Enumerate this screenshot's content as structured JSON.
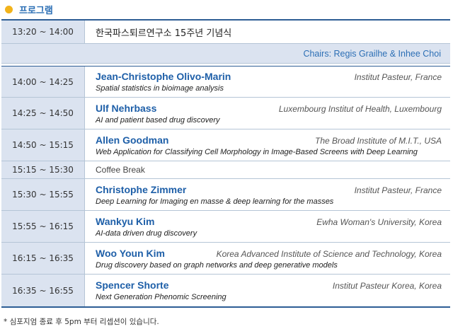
{
  "header": {
    "title": "프로그램"
  },
  "opening": {
    "time": "13:20 ~ 14:00",
    "title": "한국파스퇴르연구소 15주년 기념식"
  },
  "chairs": "Chairs: Regis Grailhe & Inhee Choi",
  "talks": [
    {
      "time": "14:00 ~ 14:25",
      "speaker": "Jean-Christophe Olivo-Marin",
      "affiliation": "Institut Pasteur, France",
      "title": "Spatial statistics in bioimage analysis"
    },
    {
      "time": "14:25 ~ 14:50",
      "speaker": "Ulf Nehrbass",
      "affiliation": "Luxembourg Institut of Health, Luxembourg",
      "title": "AI and patient based drug discovery"
    },
    {
      "time": "14:50 ~ 15:15",
      "speaker": "Allen Goodman",
      "affiliation": "The Broad Institute of M.I.T., USA",
      "title": "Web Application for Classifying Cell Morphology in Image-Based Screens with Deep Learning"
    }
  ],
  "coffee": {
    "time": "15:15 ~ 15:30",
    "label": "Coffee Break"
  },
  "talks2": [
    {
      "time": "15:30 ~ 15:55",
      "speaker": "Christophe Zimmer",
      "affiliation": "Institut Pasteur, France",
      "title": "Deep Learning for Imaging en masse & deep learning for the masses"
    },
    {
      "time": "15:55 ~ 16:15",
      "speaker": "Wankyu Kim",
      "affiliation": "Ewha Woman's University, Korea",
      "title": "AI-data driven drug discovery"
    },
    {
      "time": "16:15 ~ 16:35",
      "speaker": "Woo Youn Kim",
      "affiliation": "Korea Advanced Institute of Science and Technology, Korea",
      "title": "Drug discovery based on graph networks and deep generative models"
    },
    {
      "time": "16:35 ~ 16:55",
      "speaker": "Spencer Shorte",
      "affiliation": "Institut Pasteur Korea, Korea",
      "title": "Next Generation Phenomic Screening"
    }
  ],
  "footnote": "* 심포지엄 종료 후 5pm 부터 리셉션이 있습니다.",
  "colors": {
    "accent": "#1e5fa8",
    "time_bg": "#dbe3f0",
    "bullet": "#f2b31b"
  }
}
